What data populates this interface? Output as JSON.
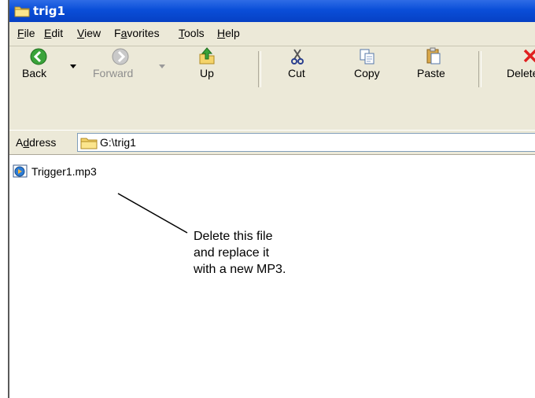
{
  "window": {
    "title": "trig1"
  },
  "menu": {
    "items": [
      {
        "label": "File",
        "underline": "F"
      },
      {
        "label": "Edit",
        "underline": "E"
      },
      {
        "label": "View",
        "underline": "V"
      },
      {
        "label": "Favorites",
        "underline": "a"
      },
      {
        "label": "Tools",
        "underline": "T"
      },
      {
        "label": "Help",
        "underline": "H"
      }
    ]
  },
  "toolbar": {
    "back_label": "Back",
    "forward_label": "Forward",
    "up_label": "Up",
    "cut_label": "Cut",
    "copy_label": "Copy",
    "paste_label": "Paste",
    "delete_label": "Delete"
  },
  "address": {
    "label": "Address",
    "label_underline": "d",
    "value": "G:\\trig1"
  },
  "files": [
    {
      "name": "Trigger1.mp3",
      "icon": "media-file-icon"
    }
  ],
  "annotation": {
    "lines": [
      "Delete this file",
      "and replace it",
      "with a new MP3."
    ]
  },
  "colors": {
    "titlebar": "#0a4ed8",
    "chrome": "#ece9d8",
    "delete_red": "#e02020",
    "back_green": "#3aa33a"
  }
}
